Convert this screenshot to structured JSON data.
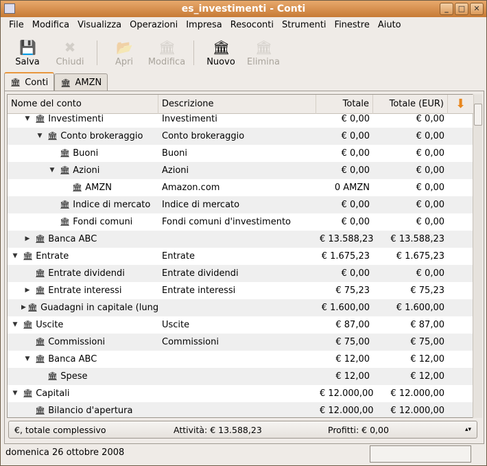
{
  "window": {
    "title": "es_investimenti - Conti",
    "buttons": [
      "_",
      "□",
      "✕"
    ]
  },
  "menu": [
    "File",
    "Modifica",
    "Visualizza",
    "Operazioni",
    "Impresa",
    "Resoconti",
    "Strumenti",
    "Finestre",
    "Aiuto"
  ],
  "toolbar": [
    {
      "label": "Salva",
      "icon": "floppy-icon",
      "enabled": true
    },
    {
      "label": "Chiudi",
      "icon": "close-icon",
      "enabled": false
    },
    {
      "label": "Apri",
      "icon": "open-account-icon",
      "enabled": false
    },
    {
      "label": "Modifica",
      "icon": "edit-account-icon",
      "enabled": false
    },
    {
      "label": "Nuovo",
      "icon": "new-account-icon",
      "enabled": true
    },
    {
      "label": "Elimina",
      "icon": "delete-account-icon",
      "enabled": false
    }
  ],
  "tabs": [
    {
      "label": "Conti",
      "active": true
    },
    {
      "label": "AMZN",
      "active": false
    }
  ],
  "columns": [
    "Nome del conto",
    "Descrizione",
    "Totale",
    "Totale (EUR)"
  ],
  "rows": [
    {
      "level": 1,
      "exp": "open",
      "name": "Investimenti",
      "desc": "Investimenti",
      "total": "€ 0,00",
      "eur": "€ 0,00"
    },
    {
      "level": 2,
      "exp": "open",
      "name": "Conto brokeraggio",
      "desc": "Conto brokeraggio",
      "total": "€ 0,00",
      "eur": "€ 0,00"
    },
    {
      "level": 3,
      "exp": "",
      "name": "Buoni",
      "desc": "Buoni",
      "total": "€ 0,00",
      "eur": "€ 0,00"
    },
    {
      "level": 3,
      "exp": "open",
      "name": "Azioni",
      "desc": "Azioni",
      "total": "€ 0,00",
      "eur": "€ 0,00"
    },
    {
      "level": 4,
      "exp": "",
      "name": "AMZN",
      "desc": "Amazon.com",
      "total": "0 AMZN",
      "eur": "€ 0,00"
    },
    {
      "level": 3,
      "exp": "",
      "name": "Indice di mercato",
      "desc": "Indice di mercato",
      "total": "€ 0,00",
      "eur": "€ 0,00"
    },
    {
      "level": 3,
      "exp": "",
      "name": "Fondi comuni",
      "desc": "Fondi comuni d'investimento",
      "total": "€ 0,00",
      "eur": "€ 0,00"
    },
    {
      "level": 1,
      "exp": "closed",
      "name": "Banca ABC",
      "desc": "",
      "total": "€ 13.588,23",
      "eur": "€ 13.588,23"
    },
    {
      "level": 0,
      "exp": "open",
      "name": "Entrate",
      "desc": "Entrate",
      "total": "€ 1.675,23",
      "eur": "€ 1.675,23"
    },
    {
      "level": 1,
      "exp": "",
      "name": "Entrate dividendi",
      "desc": "Entrate dividendi",
      "total": "€ 0,00",
      "eur": "€ 0,00"
    },
    {
      "level": 1,
      "exp": "closed",
      "name": "Entrate interessi",
      "desc": "Entrate interessi",
      "total": "€ 75,23",
      "eur": "€ 75,23"
    },
    {
      "level": 1,
      "exp": "closed",
      "name": "Guadagni in capitale (lung",
      "desc": "",
      "total": "€ 1.600,00",
      "eur": "€ 1.600,00"
    },
    {
      "level": 0,
      "exp": "open",
      "name": "Uscite",
      "desc": "Uscite",
      "total": "€ 87,00",
      "eur": "€ 87,00"
    },
    {
      "level": 1,
      "exp": "",
      "name": "Commissioni",
      "desc": "Commissioni",
      "total": "€ 75,00",
      "eur": "€ 75,00"
    },
    {
      "level": 1,
      "exp": "open",
      "name": "Banca ABC",
      "desc": "",
      "total": "€ 12,00",
      "eur": "€ 12,00"
    },
    {
      "level": 2,
      "exp": "",
      "name": "Spese",
      "desc": "",
      "total": "€ 12,00",
      "eur": "€ 12,00"
    },
    {
      "level": 0,
      "exp": "open",
      "name": "Capitali",
      "desc": "",
      "total": "€ 12.000,00",
      "eur": "€ 12.000,00"
    },
    {
      "level": 1,
      "exp": "",
      "name": "Bilancio d'apertura",
      "desc": "",
      "total": "€ 12.000,00",
      "eur": "€ 12.000,00"
    }
  ],
  "summary": {
    "currency": "€, totale complessivo",
    "assets": "Attività: € 13.588,23",
    "profits": "Profitti: € 0,00"
  },
  "status": {
    "date": "domenica 26 ottobre 2008"
  },
  "colors": {
    "titlebar": "#d08a45",
    "accent": "#e8963d"
  }
}
